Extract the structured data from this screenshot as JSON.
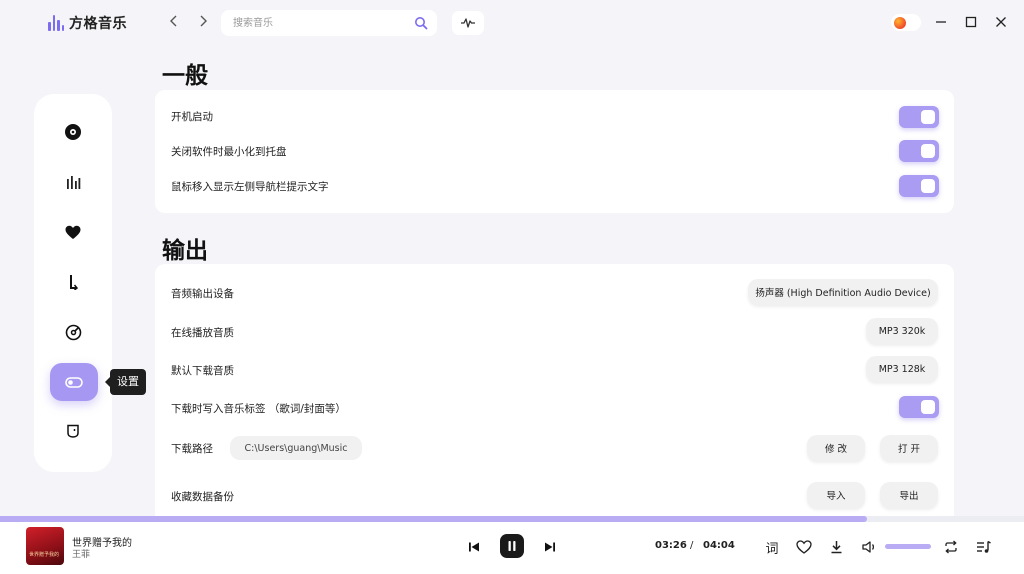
{
  "app": {
    "name": "方格音乐",
    "accent": "#a698f2"
  },
  "search": {
    "placeholder": "搜索音乐",
    "value": ""
  },
  "sidebar": {
    "items": [
      {
        "icon": "disc-icon"
      },
      {
        "icon": "chart-bars-icon"
      },
      {
        "icon": "heart-icon"
      },
      {
        "icon": "download-arrow-icon"
      },
      {
        "icon": "radar-icon"
      },
      {
        "icon": "settings-toggle-icon",
        "active": true
      },
      {
        "icon": "face-icon"
      }
    ],
    "tooltip": "设置"
  },
  "general": {
    "title": "一般",
    "rows": [
      {
        "label": "开机启动",
        "on": true
      },
      {
        "label": "关闭软件时最小化到托盘",
        "on": true
      },
      {
        "label": "鼠标移入显示左侧导航栏提示文字",
        "on": true
      }
    ]
  },
  "output": {
    "title": "输出",
    "device_label": "音频输出设备",
    "device_value": "扬声器 (High Definition Audio Device)",
    "online_quality_label": "在线播放音质",
    "online_quality_value": "MP3 320k",
    "download_quality_label": "默认下载音质",
    "download_quality_value": "MP3 128k",
    "write_tags_label": "下载时写入音乐标签 （歌词/封面等）",
    "write_tags_on": true,
    "path_label": "下载路径",
    "path_value": "C:\\Users\\guang\\Music",
    "modify_label": "修 改",
    "open_label": "打 开",
    "backup_label": "收藏数据备份",
    "import_label": "导入",
    "export_label": "导出"
  },
  "player": {
    "song_title": "世界赠予我的",
    "artist": "王菲",
    "cover_text": "世界赠予我的",
    "current_time": "03:26",
    "separator": "/",
    "total_time": "04:04",
    "progress": 0.847,
    "lyrics_label": "词",
    "volume": 1.0
  }
}
